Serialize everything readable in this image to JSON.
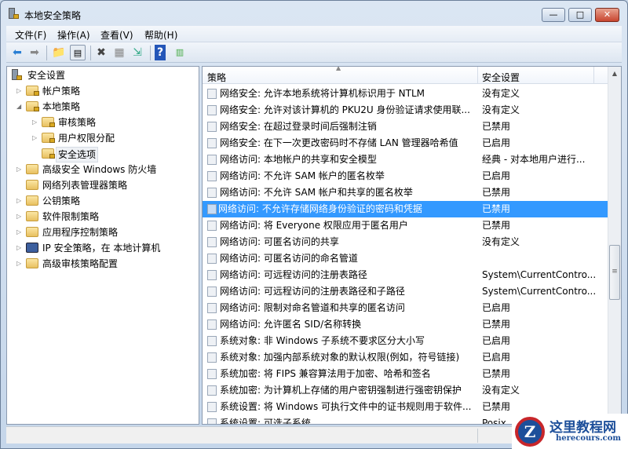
{
  "window": {
    "title": "本地安全策略",
    "minimize": "—",
    "maximize": "□",
    "close": "✕"
  },
  "menu": [
    {
      "label": "文件(F)"
    },
    {
      "label": "操作(A)"
    },
    {
      "label": "查看(V)"
    },
    {
      "label": "帮助(H)"
    }
  ],
  "toolbar": {
    "back": "back-icon",
    "forward": "forward-icon",
    "up": "up-folder-icon",
    "show_hide_tree": "console-tree-icon",
    "delete": "delete-icon",
    "properties": "properties-icon",
    "export": "export-list-icon",
    "help": "help-icon",
    "action_pane": "action-pane-icon"
  },
  "tree": {
    "root": "安全设置",
    "items": [
      {
        "label": "帐户策略"
      },
      {
        "label": "本地策略"
      },
      {
        "label": "审核策略"
      },
      {
        "label": "用户权限分配"
      },
      {
        "label": "安全选项"
      },
      {
        "label": "高级安全 Windows 防火墙"
      },
      {
        "label": "网络列表管理器策略"
      },
      {
        "label": "公钥策略"
      },
      {
        "label": "软件限制策略"
      },
      {
        "label": "应用程序控制策略"
      },
      {
        "label": "IP 安全策略，在 本地计算机"
      },
      {
        "label": "高级审核策略配置"
      }
    ]
  },
  "list": {
    "columns": {
      "policy": "策略",
      "setting": "安全设置"
    },
    "rows": [
      {
        "policy": "网络安全: 允许本地系统将计算机标识用于 NTLM",
        "setting": "没有定义"
      },
      {
        "policy": "网络安全: 允许对该计算机的 PKU2U 身份验证请求使用联...",
        "setting": "没有定义"
      },
      {
        "policy": "网络安全: 在超过登录时间后强制注销",
        "setting": "已禁用"
      },
      {
        "policy": "网络安全: 在下一次更改密码时不存储 LAN 管理器哈希值",
        "setting": "已启用"
      },
      {
        "policy": "网络访问: 本地帐户的共享和安全模型",
        "setting": "经典 - 对本地用户进行..."
      },
      {
        "policy": "网络访问: 不允许 SAM 帐户的匿名枚举",
        "setting": "已启用"
      },
      {
        "policy": "网络访问: 不允许 SAM 帐户和共享的匿名枚举",
        "setting": "已禁用"
      },
      {
        "policy": "网络访问: 不允许存储网络身份验证的密码和凭据",
        "setting": "已禁用"
      },
      {
        "policy": "网络访问: 将 Everyone 权限应用于匿名用户",
        "setting": "已禁用"
      },
      {
        "policy": "网络访问: 可匿名访问的共享",
        "setting": "没有定义"
      },
      {
        "policy": "网络访问: 可匿名访问的命名管道",
        "setting": ""
      },
      {
        "policy": "网络访问: 可远程访问的注册表路径",
        "setting": "System\\CurrentContro..."
      },
      {
        "policy": "网络访问: 可远程访问的注册表路径和子路径",
        "setting": "System\\CurrentContro..."
      },
      {
        "policy": "网络访问: 限制对命名管道和共享的匿名访问",
        "setting": "已启用"
      },
      {
        "policy": "网络访问: 允许匿名 SID/名称转换",
        "setting": "已禁用"
      },
      {
        "policy": "系统对象: 非 Windows 子系统不要求区分大小写",
        "setting": "已启用"
      },
      {
        "policy": "系统对象: 加强内部系统对象的默认权限(例如，符号链接)",
        "setting": "已启用"
      },
      {
        "policy": "系统加密: 将 FIPS 兼容算法用于加密、哈希和签名",
        "setting": "已禁用"
      },
      {
        "policy": "系统加密: 为计算机上存储的用户密钥强制进行强密钥保护",
        "setting": "没有定义"
      },
      {
        "policy": "系统设置: 将 Windows 可执行文件中的证书规则用于软件...",
        "setting": "已禁用"
      },
      {
        "policy": "系统设置: 可选子系统",
        "setting": "Posix"
      }
    ],
    "selected_index": 7
  },
  "watermark": {
    "name": "这里教程网",
    "url": "herecours.com",
    "logo": "Z"
  },
  "colors": {
    "selection": "#3399ff",
    "chrome": "#c5d6ea"
  }
}
